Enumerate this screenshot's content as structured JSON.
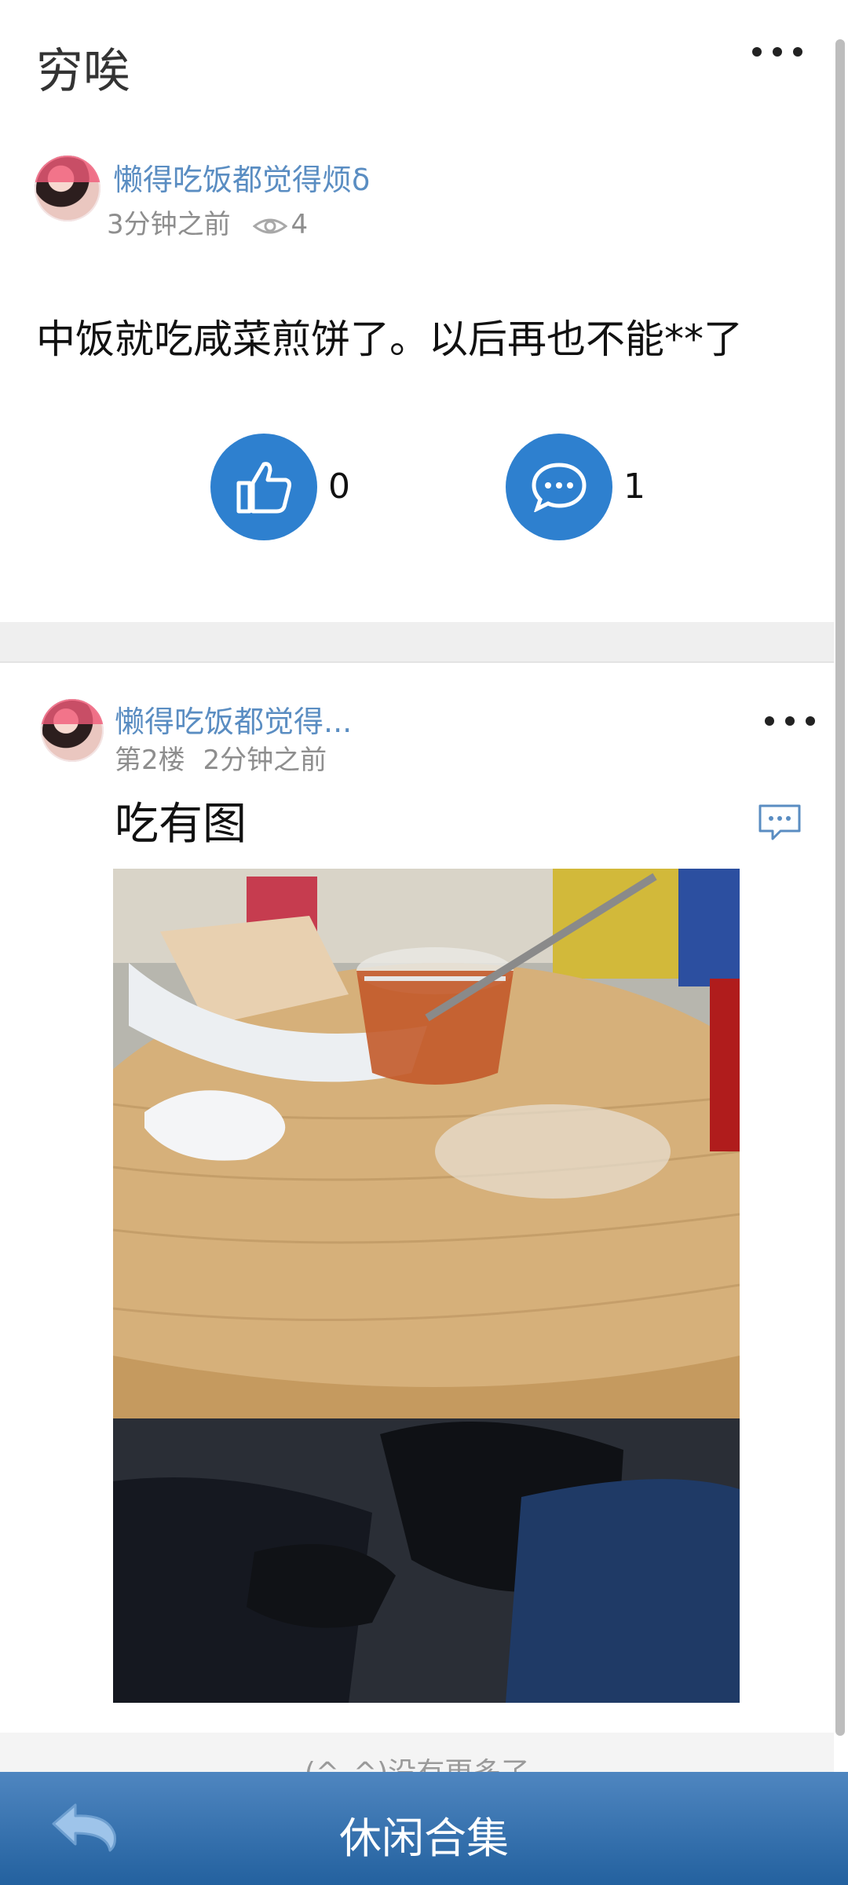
{
  "header": {
    "title": "穷唉"
  },
  "post": {
    "author": "懒得吃饭都觉得烦δ",
    "time": "3分钟之前",
    "views": "4",
    "content": "中饭就吃咸菜煎饼了。以后再也不能**了",
    "like_count": "0",
    "comment_count": "1"
  },
  "reply": {
    "author": "懒得吃饭都觉得...",
    "floor": "第2楼",
    "time": "2分钟之前",
    "text": "吃有图"
  },
  "list_end_text": "(^_^)没有更多了",
  "footer": {
    "title": "休闲合集"
  },
  "colors": {
    "accent_blue": "#2e80cf",
    "username_blue": "#5a8dc2",
    "footer_top": "#4f86c0",
    "footer_bottom": "#23619f"
  }
}
